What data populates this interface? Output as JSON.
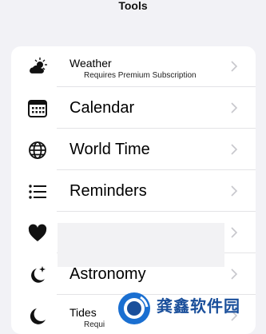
{
  "header": {
    "title": "Tools"
  },
  "items": [
    {
      "label": "Weather",
      "subtitle": "Requires Premium Subscription",
      "icon": "weather-icon"
    },
    {
      "label": "Calendar",
      "icon": "calendar-icon"
    },
    {
      "label": "World Time",
      "icon": "globe-icon"
    },
    {
      "label": "Reminders",
      "icon": "list-icon"
    },
    {
      "label": "",
      "icon": "heart-icon"
    },
    {
      "label": "Astronomy",
      "icon": "moon-stars-icon"
    },
    {
      "label": "Tides",
      "subtitle": "Requi",
      "icon": "moon-icon"
    }
  ],
  "watermark": {
    "text": "龚鑫软件园"
  },
  "colors": {
    "background": "#f2f2f6",
    "card": "#ffffff",
    "chevron": "#c7c7cc",
    "watermark": "#1a4f9b"
  }
}
